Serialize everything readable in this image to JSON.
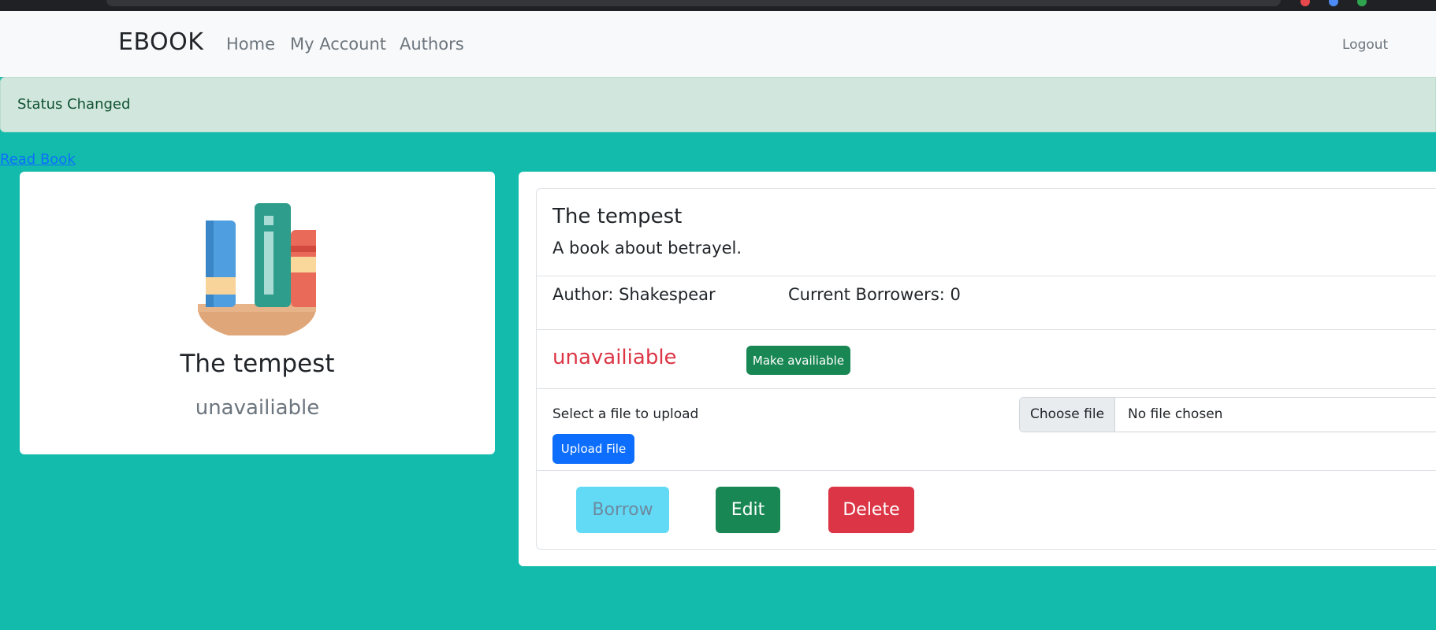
{
  "nav": {
    "brand": "EBOOK",
    "links": [
      "Home",
      "My Account",
      "Authors"
    ],
    "logout": "Logout"
  },
  "alert": {
    "message": "Status Changed"
  },
  "read_link": "Read Book",
  "left_card": {
    "icon": "books-icon",
    "title": "The tempest",
    "status": "unavailiable"
  },
  "detail": {
    "title": "The tempest",
    "description": "A book about betrayel.",
    "author": "Author: Shakespear",
    "borrowers": "Current Borrowers: 0",
    "status": "unavailiable",
    "make_available": "Make availiable",
    "upload_label": "Select a file to upload",
    "choose_file": "Choose file",
    "no_file": "No file chosen",
    "upload_button": "Upload File",
    "borrow": "Borrow",
    "edit": "Edit",
    "delete": "Delete"
  },
  "colors": {
    "background": "#12bbab",
    "danger": "#dc3545",
    "success": "#198754",
    "primary": "#0d6efd",
    "info": "#62daf6"
  }
}
